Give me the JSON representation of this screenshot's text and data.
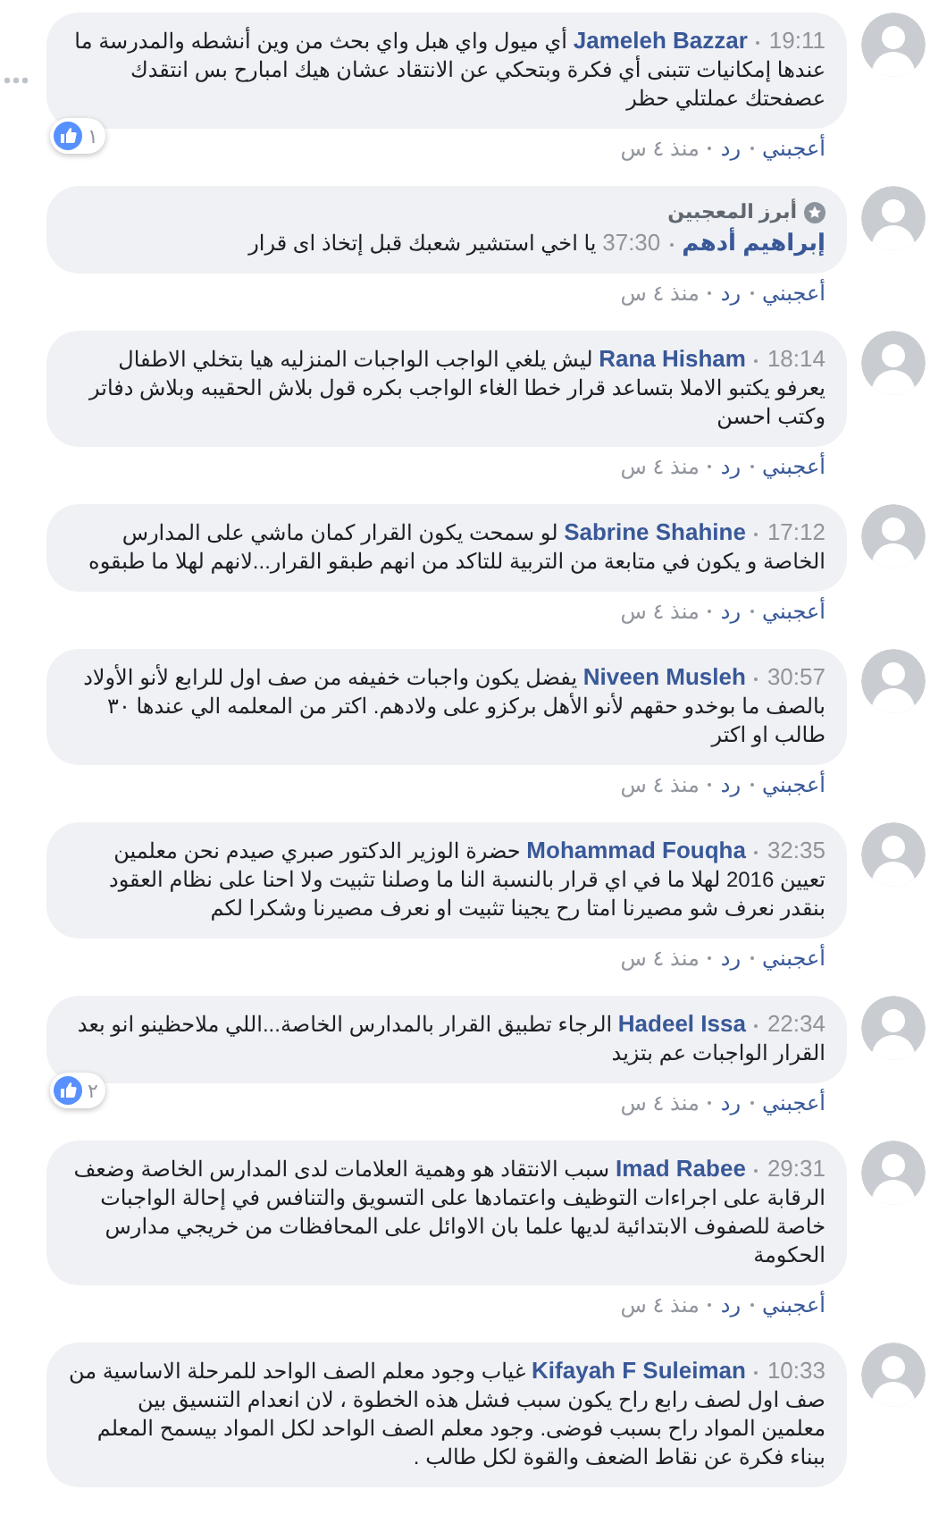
{
  "comments": [
    {
      "author": "Jameleh Bazzar",
      "time": "19:11",
      "text": "أي ميول واي هبل واي بحث من وين أنشطه والمدرسة ما عندها إمكانيات تتبنى أي فكرة وبتحكي عن الانتقاد عشان هيك امبارح بس انتقدك عصفحتك عملتلي حظر",
      "reactions": "١",
      "show_menu": true,
      "actions": [
        "أعجبني",
        "رد",
        "منذ ٤ س"
      ]
    },
    {
      "author": "إبراهيم أدهم",
      "time": "37:30",
      "text": "يا اخي استشير شعبك قبل إتخاذ اى قرار",
      "badge": "أبرز المعجبين",
      "show_menu": false,
      "actions": [
        "أعجبني",
        "رد",
        "منذ ٤ س"
      ]
    },
    {
      "author": "Rana Hisham",
      "time": "18:14",
      "text": "ليش يلغي الواجب الواجبات المنزليه هيا بتخلي الاطفال يعرفو يكتبو الاملا بتساعد قرار خطا الغاء الواجب بكره قول بلاش الحقيبه وبلاش دفاتر وكتب احسن",
      "show_menu": false,
      "actions": [
        "أعجبني",
        "رد",
        "منذ ٤ س"
      ]
    },
    {
      "author": "Sabrine Shahine",
      "time": "17:12",
      "text": "لو سمحت يكون القرار كمان ماشي على المدارس الخاصة و يكون في متابعة من التربية للتاكد من انهم طبقو القرار...لانهم لهلا ما طبقوه",
      "show_menu": false,
      "actions": [
        "أعجبني",
        "رد",
        "منذ ٤ س"
      ]
    },
    {
      "author": "Niveen Musleh",
      "time": "30:57",
      "text": "يفضل يكون واجبات خفيفه من صف اول للرابع لأنو الأولاد بالصف ما بوخدو حقهم لأنو الأهل بركزو على ولادهم. اكتر من المعلمه الي عندها ٣٠ طالب او اكتر",
      "show_menu": false,
      "actions": [
        "أعجبني",
        "رد",
        "منذ ٤ س"
      ]
    },
    {
      "author": "Mohammad Fouqha",
      "time": "32:35",
      "text": "حضرة الوزير الدكتور صبري صيدم نحن معلمين تعيين 2016 لهلا ما في اي قرار بالنسبة النا ما وصلنا تثبيت ولا احنا على نظام العقود بنقدر نعرف شو مصيرنا امتا رح يجينا تثبيت او نعرف مصيرنا وشكرا لكم",
      "show_menu": false,
      "actions": [
        "أعجبني",
        "رد",
        "منذ ٤ س"
      ]
    },
    {
      "author": "Hadeel Issa",
      "time": "22:34",
      "text": "الرجاء تطبيق القرار بالمدارس الخاصة...اللي ملاحظينو انو بعد القرار الواجبات عم بتزيد",
      "reactions": "٢",
      "show_menu": false,
      "actions": [
        "أعجبني",
        "رد",
        "منذ ٤ س"
      ]
    },
    {
      "author": "Imad Rabee",
      "time": "29:31",
      "text": "سبب الانتقاد هو وهمية العلامات لدى المدارس الخاصة وضعف الرقابة على اجراءات التوظيف واعتمادها على التسويق والتنافس في إحالة الواجبات خاصة للصفوف الابتدائية لديها علما بان الاوائل على المحافظات من خريجي مدارس الحكومة",
      "show_menu": false,
      "actions": [
        "أعجبني",
        "رد",
        "منذ ٤ س"
      ]
    },
    {
      "author": "Kifayah F Suleiman",
      "time": "10:33",
      "text": "غياب وجود معلم الصف الواحد للمرحلة الاساسية من صف اول لصف رابع راح يكون سبب فشل هذه الخطوة ، لان انعدام التنسيق بين معلمين المواد راح بسبب فوضى. وجود معلم الصف الواحد لكل المواد بيسمح المعلم ببناء فكرة عن نقاط الضعف والقوة لكل طالب .",
      "show_menu": false
    }
  ]
}
